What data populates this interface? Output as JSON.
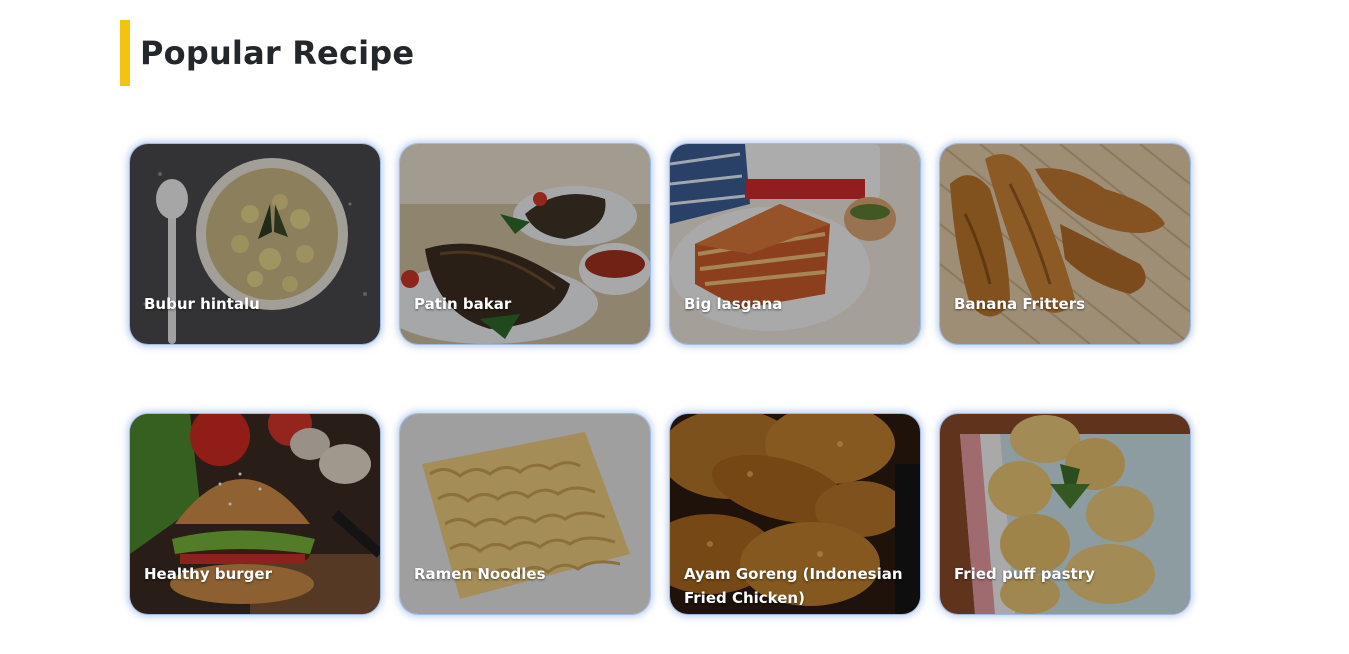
{
  "section": {
    "title": "Popular Recipe",
    "accent_color": "#f2c40f"
  },
  "recipes": [
    {
      "name": "Bubur hintalu",
      "image": "bowl-of-porridge-photo"
    },
    {
      "name": "Patin bakar",
      "image": "grilled-fish-photo"
    },
    {
      "name": "Big lasgana",
      "image": "lasagna-photo"
    },
    {
      "name": "Banana Fritters",
      "image": "banana-fritters-photo"
    },
    {
      "name": "Healthy burger",
      "image": "burger-photo"
    },
    {
      "name": "Ramen Noodles",
      "image": "dry-noodle-block-photo"
    },
    {
      "name": "Ayam Goreng (Indonesian Fried Chicken)",
      "image": "fried-chicken-photo"
    },
    {
      "name": "Fried puff pastry",
      "image": "puff-pastry-photo"
    }
  ]
}
